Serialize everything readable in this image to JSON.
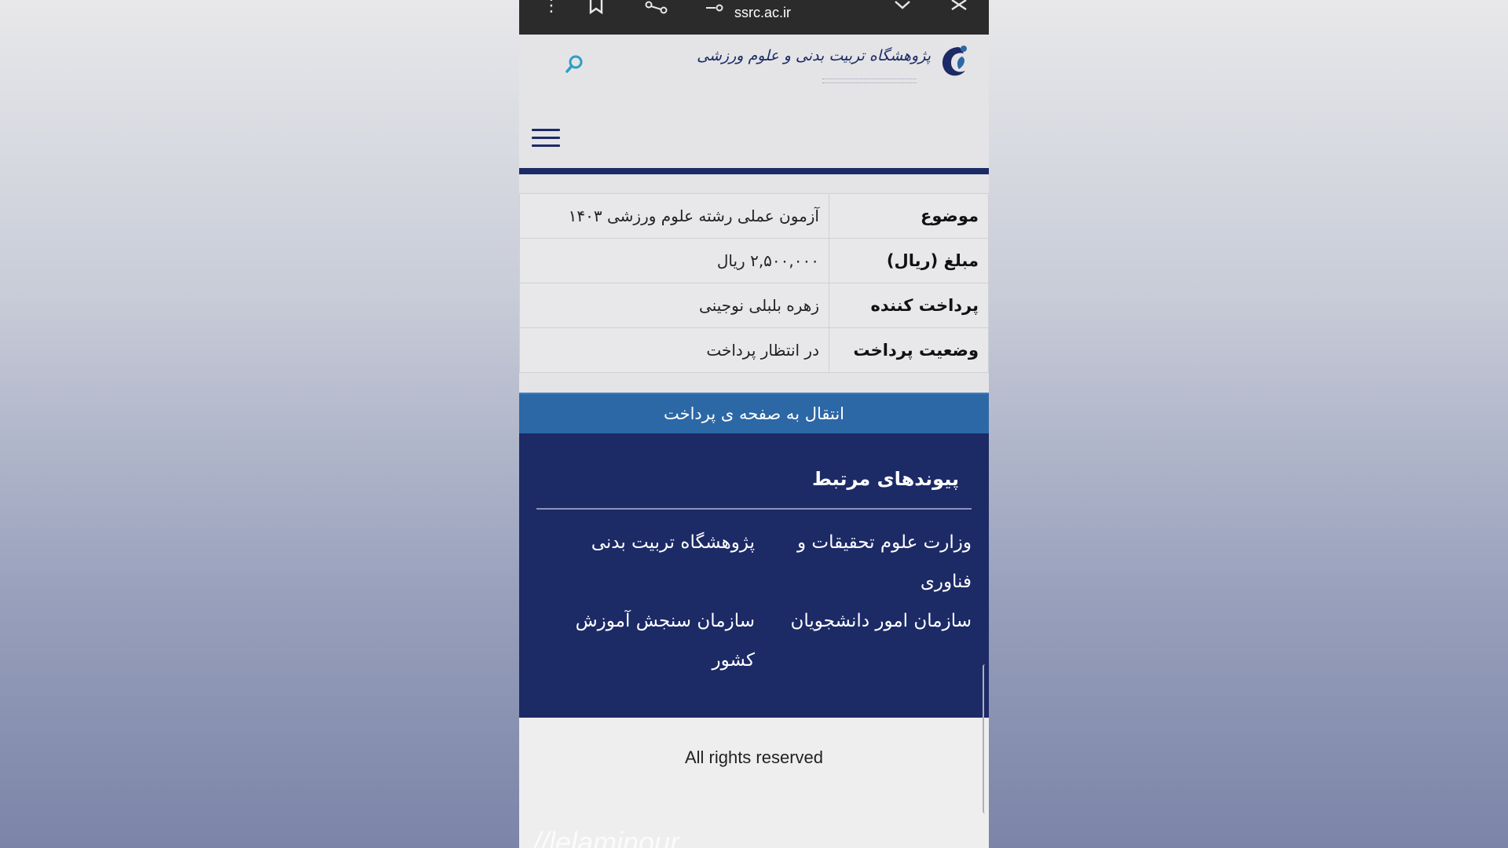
{
  "browser": {
    "url": "ssrc.ac.ir"
  },
  "header": {
    "logo_text": "پژوهشگاه تربیت بدنی و علوم ورزشی",
    "accent_color": "#1c2a66"
  },
  "table": {
    "rows": [
      {
        "label": "موضوع",
        "value": "آزمون عملی رشته علوم ورزشی ۱۴۰۳"
      },
      {
        "label": "مبلغ (ریال)",
        "value": "۲,۵۰۰,۰۰۰ ریال"
      },
      {
        "label": "پرداخت کننده",
        "value": "زهره بلبلی نوجینی"
      },
      {
        "label": "وضعیت پرداخت",
        "value": "در انتظار پرداخت"
      }
    ]
  },
  "pay_button": {
    "label": "انتقال به صفحه ی پرداخت",
    "color": "#2c68a6"
  },
  "related": {
    "title": "پیوندهای مرتبط",
    "links": [
      "وزارت علوم تحقیقات و فناوری",
      "پژوهشگاه تربیت بدنی",
      "سازمان امور دانشجویان",
      "سازمان سنجش آموزش کشور"
    ]
  },
  "footer": {
    "text": "All rights reserved"
  },
  "watermark": {
    "text": "//lelaminour"
  }
}
